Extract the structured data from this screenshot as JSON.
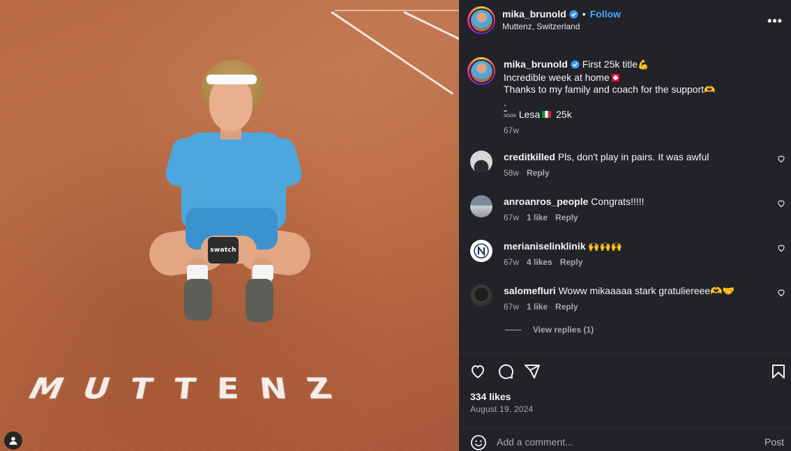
{
  "photo": {
    "court_text": "MUTTENZ",
    "trophy_text": "swatch"
  },
  "header": {
    "username": "mika_brunold",
    "follow_label": "Follow",
    "separator": "•",
    "location": "Muttenz, Switzerland",
    "more_label": "•••"
  },
  "caption": {
    "username": "mika_brunold",
    "line1_text": "First 25k title",
    "line2_text": "Incredible week at home",
    "line3_text": "Thanks to my family and coach for the support",
    "line4_text": ".",
    "line5_arrow": "SOON",
    "line5_text": "Lesa",
    "line5_tail": "25k",
    "time": "67w"
  },
  "comments": [
    {
      "username": "creditkilled",
      "text": "Pls, don't play in pairs. It was awful",
      "time": "58w",
      "likes": "",
      "reply": "Reply"
    },
    {
      "username": "anroanros_people",
      "text": "Congrats!!!!!",
      "time": "67w",
      "likes": "1 like",
      "reply": "Reply"
    },
    {
      "username": "merianiselinklinik",
      "text": "🙌🙌🙌",
      "time": "67w",
      "likes": "4 likes",
      "reply": "Reply"
    },
    {
      "username": "salomefluri",
      "text": "Woww mikaaaaa stark gratuliereee🫶🤝",
      "time": "67w",
      "likes": "1 like",
      "reply": "Reply"
    }
  ],
  "view_replies": "View replies (1)",
  "actions": {
    "icons": [
      "heart-icon",
      "comment-icon",
      "share-icon",
      "bookmark-icon"
    ],
    "likes": "334 likes",
    "date": "August 19, 2024"
  },
  "add_comment": {
    "placeholder": "Add a comment...",
    "post_label": "Post"
  },
  "colors": {
    "panel_bg": "#212328",
    "link_blue": "#4aa3ff",
    "muted": "#a8a8a8"
  }
}
